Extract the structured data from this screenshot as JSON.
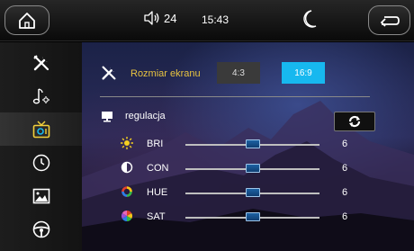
{
  "topbar": {
    "volume": "24",
    "time": "15:43"
  },
  "sidebar": {
    "items": [
      {
        "icon": "tools-icon",
        "active": false
      },
      {
        "icon": "music-settings-icon",
        "active": false
      },
      {
        "icon": "tv-display-icon",
        "active": true
      },
      {
        "icon": "clock-icon",
        "active": false
      },
      {
        "icon": "picture-icon",
        "active": false
      },
      {
        "icon": "steering-wheel-icon",
        "active": false
      }
    ]
  },
  "screen_size": {
    "label": "Rozmiar ekranu",
    "options": [
      "4:3",
      "16:9"
    ],
    "selected": "16:9"
  },
  "regulation": {
    "label": "regulacja",
    "sliders": [
      {
        "icon": "sun-icon",
        "label": "BRI",
        "value": "6",
        "level": 0.5
      },
      {
        "icon": "contrast-icon",
        "label": "CON",
        "value": "6",
        "level": 0.5
      },
      {
        "icon": "hue-icon",
        "label": "HUE",
        "value": "6",
        "level": 0.5
      },
      {
        "icon": "saturation-icon",
        "label": "SAT",
        "value": "6",
        "level": 0.5
      }
    ]
  },
  "colors": {
    "accent": "#17b8ef",
    "title_yellow": "#e8c341",
    "slider_thumb": "#1d62a3"
  }
}
